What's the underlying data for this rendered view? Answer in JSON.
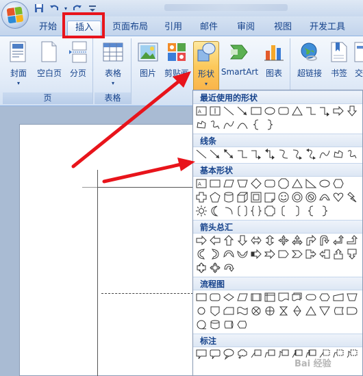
{
  "quick_access": {
    "save": "save-icon",
    "undo": "undo-icon",
    "redo": "redo-icon"
  },
  "tabs": [
    "开始",
    "插入",
    "页面布局",
    "引用",
    "邮件",
    "审阅",
    "视图",
    "开发工具"
  ],
  "active_tab": "插入",
  "groups": {
    "pages": {
      "label": "页",
      "buttons": [
        "封面",
        "空白页",
        "分页"
      ]
    },
    "table": {
      "label": "表格",
      "buttons": [
        "表格"
      ]
    },
    "illustrations": {
      "buttons": [
        "图片",
        "剪贴画",
        "形状",
        "SmartArt",
        "图表"
      ]
    },
    "links": {
      "buttons": [
        "超链接",
        "书签",
        "交"
      ]
    }
  },
  "shape_gallery": {
    "sections": [
      "最近使用的形状",
      "线条",
      "基本形状",
      "箭头总汇",
      "流程图",
      "标注"
    ]
  },
  "watermark": "Bai 经验",
  "colors": {
    "highlight_red": "#e8141b",
    "accent_blue": "#15428b"
  }
}
